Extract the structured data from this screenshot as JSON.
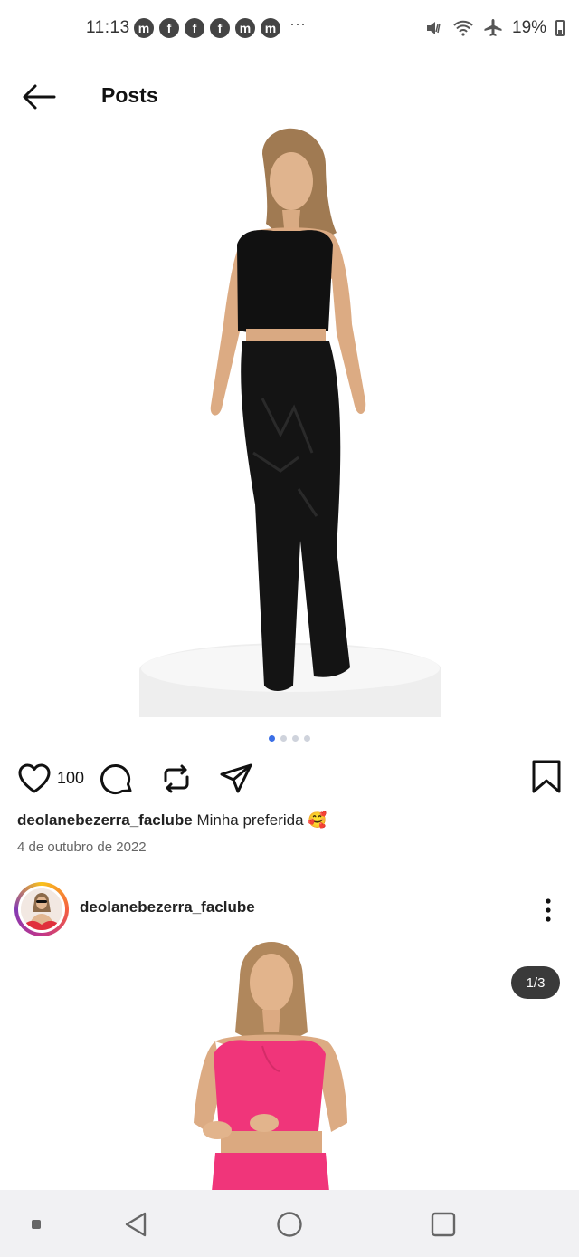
{
  "status_bar": {
    "time": "11:13",
    "notification_icons": [
      "messenger-icon",
      "facebook-icon",
      "facebook-icon",
      "facebook-icon",
      "messenger-icon",
      "messenger-icon"
    ],
    "more": "···",
    "battery": "19%"
  },
  "header": {
    "title": "Posts"
  },
  "post": {
    "likes": "100",
    "username": "deolanebezerra_faclube",
    "caption": "Minha preferida 🥰",
    "date": "4 de outubro de 2022",
    "carousel": {
      "total": 4,
      "active": 1
    }
  },
  "next_post": {
    "username": "deolanebezerra_faclube",
    "counter": "1/3"
  },
  "colors": {
    "accent_dot": "#3b6fe6",
    "top_color_post1": "#111111",
    "top_color_post2": "#f0357a"
  }
}
